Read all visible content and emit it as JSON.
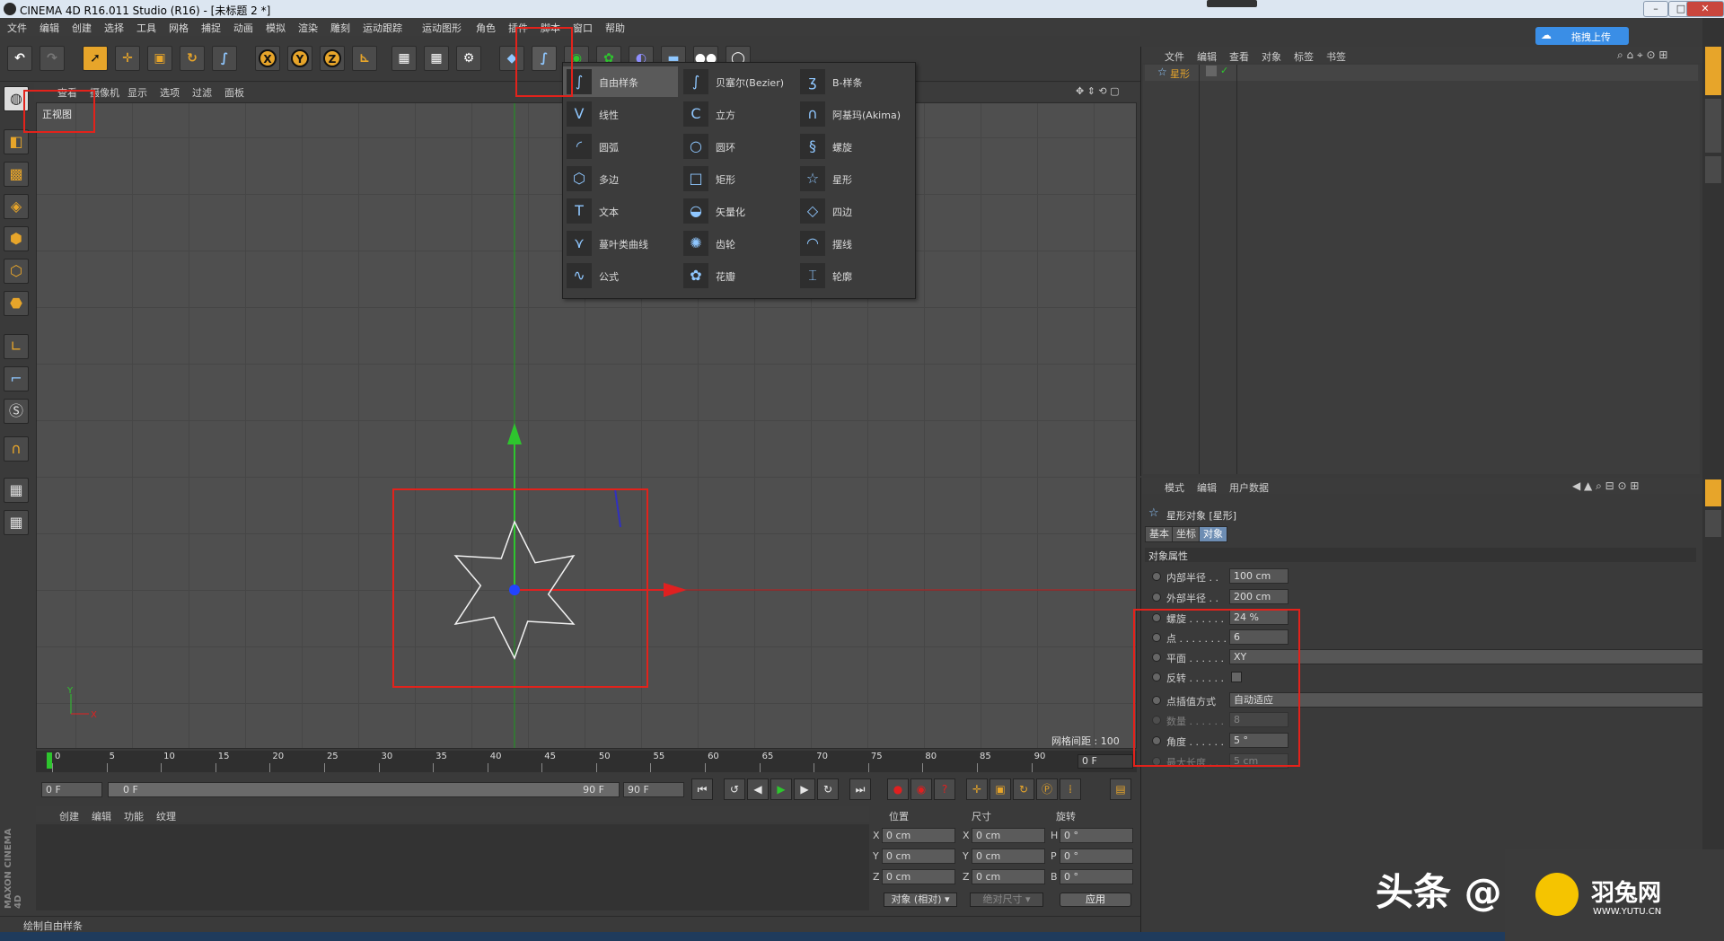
{
  "window": {
    "title": "CINEMA 4D R16.011 Studio (R16) - [未标题 2 *]"
  },
  "menubar": [
    "文件",
    "编辑",
    "创建",
    "选择",
    "工具",
    "网格",
    "捕捉",
    "动画",
    "模拟",
    "渲染",
    "雕刻",
    "运动跟踪",
    "运动图形",
    "角色",
    "插件",
    "脚本",
    "窗口",
    "帮助"
  ],
  "viewport": {
    "menu": [
      "查看",
      "摄像机",
      "显示",
      "选项",
      "过滤",
      "面板"
    ],
    "view_name": "正视图",
    "grid_info": "网格间距 : 100 cm",
    "axis_y": "Y",
    "axis_x": "X"
  },
  "spline_menu": {
    "col1": [
      {
        "label": "自由样条",
        "icon": "freehand-spline-icon"
      },
      {
        "label": "线性",
        "icon": "linear-spline-icon"
      },
      {
        "label": "圆弧",
        "icon": "arc-icon"
      },
      {
        "label": "多边",
        "icon": "polygon-spline-icon"
      },
      {
        "label": "文本",
        "icon": "text-spline-icon"
      },
      {
        "label": "蔓叶类曲线",
        "icon": "cissoid-icon"
      },
      {
        "label": "公式",
        "icon": "formula-spline-icon"
      }
    ],
    "col2": [
      {
        "label": "贝塞尔(Bezier)",
        "icon": "bezier-icon"
      },
      {
        "label": "立方",
        "icon": "cubic-icon"
      },
      {
        "label": "圆环",
        "icon": "circle-icon"
      },
      {
        "label": "矩形",
        "icon": "rectangle-icon"
      },
      {
        "label": "矢量化",
        "icon": "vectorizer-icon"
      },
      {
        "label": "齿轮",
        "icon": "cogwheel-icon"
      },
      {
        "label": "花瓣",
        "icon": "flower-icon"
      }
    ],
    "col3": [
      {
        "label": "B-样条",
        "icon": "b-spline-icon"
      },
      {
        "label": "阿基玛(Akima)",
        "icon": "akima-icon"
      },
      {
        "label": "螺旋",
        "icon": "helix-icon"
      },
      {
        "label": "星形",
        "icon": "star-icon"
      },
      {
        "label": "四边",
        "icon": "4-side-icon"
      },
      {
        "label": "摆线",
        "icon": "cycloid-icon"
      },
      {
        "label": "轮廓",
        "icon": "profile-icon"
      }
    ]
  },
  "timeline": {
    "ticks": [
      "0",
      "5",
      "10",
      "15",
      "20",
      "25",
      "30",
      "35",
      "40",
      "45",
      "50",
      "55",
      "60",
      "65",
      "70",
      "75",
      "80",
      "85",
      "90"
    ],
    "current_frame": "0 F",
    "start_field": "0 F",
    "range_start": "0 F",
    "range_end": "90 F",
    "end_field": "90 F"
  },
  "material_panel": {
    "menu": [
      "创建",
      "编辑",
      "功能",
      "纹理"
    ]
  },
  "coord_panel": {
    "headers": [
      "位置",
      "尺寸",
      "旋转"
    ],
    "rows": [
      {
        "a": "X",
        "av": "0 cm",
        "b": "X",
        "bv": "0 cm",
        "c": "H",
        "cv": "0 °"
      },
      {
        "a": "Y",
        "av": "0 cm",
        "b": "Y",
        "bv": "0 cm",
        "c": "P",
        "cv": "0 °"
      },
      {
        "a": "Z",
        "av": "0 cm",
        "b": "Z",
        "bv": "0 cm",
        "c": "B",
        "cv": "0 °"
      }
    ],
    "mode_select": "对象 (相对)",
    "size_select": "绝对尺寸",
    "apply": "应用"
  },
  "object_manager": {
    "menu": [
      "文件",
      "编辑",
      "查看",
      "对象",
      "标签",
      "书签"
    ],
    "items": [
      {
        "name": "星形"
      }
    ]
  },
  "attribute_manager": {
    "menu": [
      "模式",
      "编辑",
      "用户数据"
    ],
    "object_title": "星形对象 [星形]",
    "tabs": [
      "基本",
      "坐标",
      "对象"
    ],
    "section": "对象属性",
    "props": [
      {
        "name": "内部半径 . .",
        "value": "100 cm"
      },
      {
        "name": "外部半径 . .",
        "value": "200 cm"
      },
      {
        "name": "螺旋 . . . . . .",
        "value": "24 %"
      },
      {
        "name": "点 . . . . . . . .",
        "value": "6"
      },
      {
        "name": "平面 . . . . . .",
        "value": "XY",
        "wide": true
      },
      {
        "name": "反转 . . . . . .",
        "value": "",
        "checkbox": true
      },
      {
        "name": "点插值方式",
        "value": "自动适应",
        "wide": true
      },
      {
        "name": "数量 . . . . . .",
        "value": "8"
      },
      {
        "name": "角度 . . . . . .",
        "value": "5 °"
      },
      {
        "name": "最大长度 . .",
        "value": "5 cm"
      }
    ]
  },
  "upload_button": "拖拽上传",
  "status": "绘制自由样条",
  "watermark": {
    "toutiao": "头条 @",
    "yutu_name": "羽兔网",
    "yutu_url": "WWW.YUTU.CN"
  },
  "maxon_logo": "MAXON CINEMA 4D",
  "colors": {
    "accent_orange": "#e7a52a",
    "highlight_red": "#e3221b",
    "axis_green": "#2ec52e",
    "axis_red": "#e02020",
    "point_blue": "#2244ff"
  }
}
